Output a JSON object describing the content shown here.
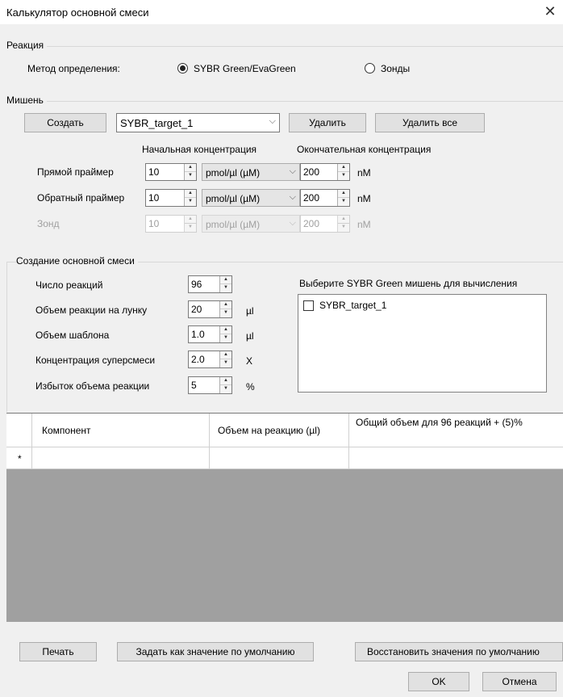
{
  "window": {
    "title": "Калькулятор основной смеси",
    "close_glyph": "✕"
  },
  "reaction": {
    "legend": "Реакция",
    "method_label": "Метод определения:",
    "options": [
      {
        "label": "SYBR Green/EvaGreen",
        "checked": true
      },
      {
        "label": "Зонды",
        "checked": false
      }
    ]
  },
  "target": {
    "legend": "Мишень",
    "create_label": "Создать",
    "selected": "SYBR_target_1",
    "delete_label": "Удалить",
    "delete_all_label": "Удалить все",
    "initial_conc_header": "Начальная концентрация",
    "final_conc_header": "Окончательная концентрация",
    "rows": [
      {
        "label": "Прямой праймер",
        "initial": "10",
        "unit": "pmol/µl  (µM)",
        "final": "200",
        "final_unit": "nM",
        "enabled": true
      },
      {
        "label": "Обратный праймер",
        "initial": "10",
        "unit": "pmol/µl  (µM)",
        "final": "200",
        "final_unit": "nM",
        "enabled": true
      },
      {
        "label": "Зонд",
        "initial": "10",
        "unit": "pmol/µl  (µM)",
        "final": "200",
        "final_unit": "nM",
        "enabled": false
      }
    ]
  },
  "mastermix": {
    "legend": "Создание основной смеси",
    "fields": [
      {
        "label": "Число реакций",
        "value": "96",
        "unit": ""
      },
      {
        "label": "Объем реакции на лунку",
        "value": "20",
        "unit": "µl"
      },
      {
        "label": "Объем шаблона",
        "value": "1.0",
        "unit": "µl"
      },
      {
        "label": "Концентрация суперсмеси",
        "value": "2.0",
        "unit": "X"
      },
      {
        "label": "Избыток объема реакции",
        "value": "5",
        "unit": "%"
      }
    ],
    "targets_label": "Выберите SYBR Green мишень для вычисления",
    "targets": [
      {
        "label": "SYBR_target_1",
        "checked": false
      }
    ]
  },
  "grid": {
    "columns": [
      "Компонент",
      "Объем на реакцию (µl)",
      "Общий объем для 96 реакций + (5)%"
    ],
    "new_row_marker": "*"
  },
  "footer": {
    "print_label": "Печать",
    "set_default_label": "Задать как значение по умолчанию",
    "restore_label": "Восстановить значения по умолчанию",
    "ok_label": "OK",
    "cancel_label": "Отмена"
  }
}
